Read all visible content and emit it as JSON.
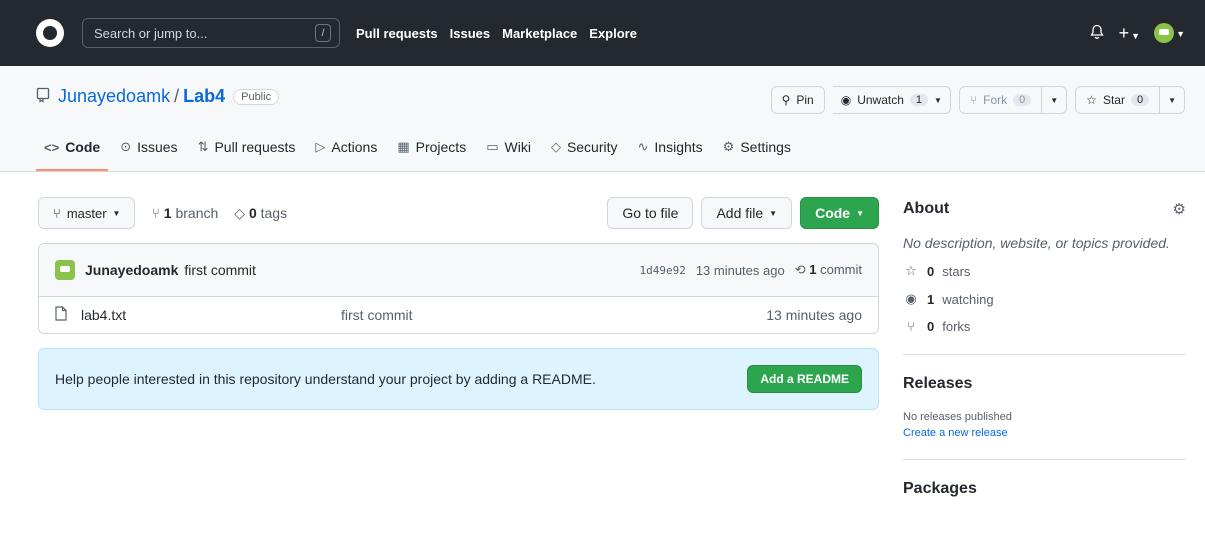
{
  "header": {
    "search_placeholder": "Search or jump to...",
    "search_shortcut": "/",
    "nav": [
      "Pull requests",
      "Issues",
      "Marketplace",
      "Explore"
    ],
    "plus": "+"
  },
  "repo": {
    "owner": "Junayedoamk",
    "separator": "/",
    "name": "Lab4",
    "visibility": "Public",
    "pin_label": "Pin",
    "unwatch_label": "Unwatch",
    "watch_count": "1",
    "fork_label": "Fork",
    "fork_count": "0",
    "star_label": "Star",
    "star_count": "0"
  },
  "tabs": [
    {
      "label": "Code",
      "icon": "<>"
    },
    {
      "label": "Issues",
      "icon": "⊙"
    },
    {
      "label": "Pull requests",
      "icon": "⇅"
    },
    {
      "label": "Actions",
      "icon": "▷"
    },
    {
      "label": "Projects",
      "icon": "▦"
    },
    {
      "label": "Wiki",
      "icon": "▭"
    },
    {
      "label": "Security",
      "icon": "◇"
    },
    {
      "label": "Insights",
      "icon": "∿"
    },
    {
      "label": "Settings",
      "icon": "⚙"
    }
  ],
  "filenav": {
    "branch": "master",
    "branch_count": "1",
    "branch_word": "branch",
    "tag_count": "0",
    "tag_word": "tags",
    "goto_file": "Go to file",
    "add_file": "Add file",
    "code": "Code"
  },
  "commit": {
    "author": "Junayedoamk",
    "message": "first commit",
    "sha": "1d49e92",
    "time": "13 minutes ago",
    "count": "1",
    "count_word": "commit"
  },
  "files": [
    {
      "name": "lab4.txt",
      "message": "first commit",
      "time": "13 minutes ago"
    }
  ],
  "readme": {
    "text": "Help people interested in this repository understand your project by adding a README.",
    "button": "Add a README"
  },
  "about": {
    "title": "About",
    "description": "No description, website, or topics provided.",
    "stars_count": "0",
    "stars_word": "stars",
    "watching_count": "1",
    "watching_word": "watching",
    "forks_count": "0",
    "forks_word": "forks"
  },
  "releases": {
    "title": "Releases",
    "none": "No releases published",
    "create_link": "Create a new release"
  },
  "packages": {
    "title": "Packages"
  }
}
